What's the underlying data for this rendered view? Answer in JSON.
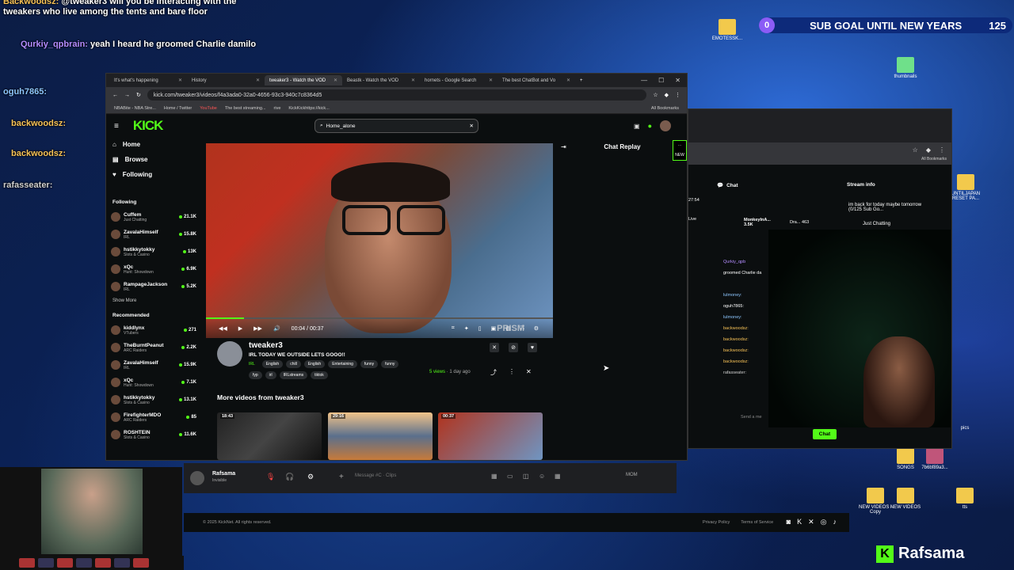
{
  "overlay_chat": [
    {
      "user": "Backwoodsz:",
      "text": "@tweaker3 will you be interacting with the tweakers who live among the tents and bare floor",
      "color": "orange"
    },
    {
      "user": "Qurkiy_qpbrain:",
      "text": "yeah I heard he groomed Charlie damilo",
      "color": "purple"
    },
    {
      "user": "oguh7865:",
      "text": "",
      "color": "blue"
    },
    {
      "user": "backwoodsz:",
      "text": "",
      "color": "orange"
    },
    {
      "user": "backwoodsz:",
      "text": "",
      "color": "orange"
    },
    {
      "user": "rafasseater:",
      "text": "",
      "color": "grey"
    }
  ],
  "sub_goal": {
    "count": "0",
    "label": "SUB GOAL UNTIL NEW YEARS",
    "goal": "125"
  },
  "desktop_icons": [
    {
      "label": "EMOTESSK..."
    },
    {
      "label": "thumbnails"
    },
    {
      "label": "UNTILJAPAN RESET PA..."
    },
    {
      "label": "SONGS"
    },
    {
      "label": "7b6bf89a3..."
    },
    {
      "label": "NEW VIDEOS - Copy"
    },
    {
      "label": "NEW VIDEOS"
    },
    {
      "label": "tts"
    },
    {
      "label": "pics"
    }
  ],
  "browser": {
    "tabs": [
      "It's what's happening",
      "History",
      "tweaker3 - Watch the VOD",
      "Beastk - Watch the VOD",
      "hornets - Google Search",
      "The best ChatBot and Vo"
    ],
    "url": "kick.com/tweaker3/videos/f4a3ada0-32a0-4656-93c3-940c7c8364d5",
    "bookmarks": [
      "NBABite - NBA Stre...",
      "Home / Twitter",
      "YouTube",
      "The best streaming...",
      "rive",
      "KickKickhttps://kick..."
    ],
    "all_bookmarks": "All Bookmarks"
  },
  "kick": {
    "search_value": "Home_alone",
    "nav": [
      {
        "label": "Home"
      },
      {
        "label": "Browse"
      },
      {
        "label": "Following"
      }
    ],
    "following_title": "Following",
    "following": [
      {
        "name": "Cuffem",
        "cat": "Just Chatting",
        "viewers": "21.1K"
      },
      {
        "name": "ZavalaHimself",
        "cat": "IRL",
        "viewers": "15.8K"
      },
      {
        "name": "hstikkytokky",
        "cat": "Slots & Casino",
        "viewers": "13K"
      },
      {
        "name": "xQc",
        "cat": "Hunt: Showdown",
        "viewers": "6.9K"
      },
      {
        "name": "RampageJackson",
        "cat": "IRL",
        "viewers": "5.2K"
      }
    ],
    "show_more": "Show More",
    "recommended_title": "Recommended",
    "recommended": [
      {
        "name": "kiddlynx",
        "cat": "VTubers",
        "viewers": "271"
      },
      {
        "name": "TheBurntPeanut",
        "cat": "ARC Raiders",
        "viewers": "2.2K"
      },
      {
        "name": "ZavalaHimself",
        "cat": "IRL",
        "viewers": "15.9K"
      },
      {
        "name": "xQc",
        "cat": "Hunt: Showdown",
        "viewers": "7.1K"
      },
      {
        "name": "hstikkytokky",
        "cat": "Slots & Casino",
        "viewers": "13.1K"
      },
      {
        "name": "FirefighterMDO",
        "cat": "ARC Raiders",
        "viewers": "85"
      },
      {
        "name": "ROSHTEIN",
        "cat": "Slots & Casino",
        "viewers": "11.6K"
      }
    ],
    "player": {
      "time": "00:04 / 00:37",
      "progress": 0.11,
      "watermark": "PRISM"
    },
    "chat_replay": "Chat Replay",
    "new_badge": "NEW",
    "streamer": "tweaker3",
    "title": "IRL TODAY WE OUTSIDE LETS GOOO!!",
    "category": "IRL",
    "tags": [
      "English",
      "chill",
      "English",
      "Entertaining",
      "funny",
      "funny",
      "fyp",
      "irl",
      "IRLstreams",
      "tiktok"
    ],
    "views": "5 views",
    "ago": "1 day ago",
    "more_videos": "More videos from tweaker3",
    "thumbs": [
      {
        "dur": "18:43"
      },
      {
        "dur": "29:16"
      },
      {
        "dur": "00:37"
      }
    ]
  },
  "browser2": {
    "all_bookmarks": "All Bookmarks",
    "chat_label": "Chat",
    "stream_info": "Stream info",
    "time": "27:54",
    "top_user": "MonkeyInA...",
    "top_user_sub": "3.5K",
    "top_right": "Dra...",
    "top_right_count": "463",
    "stream_title": "im back for today maybe tomorrow (0/125 Sub Go...",
    "stream_cat": "Just Chatting",
    "chat_users": [
      "Qurkiy_qpb",
      "groomed Charlie da",
      "lulmoney:",
      "oguh7865:",
      "lulmoney:",
      "backwoodsz:",
      "backwoodsz:",
      "backwoodsz:",
      "backwoodsz:",
      "rafasseater:"
    ],
    "send_placeholder": "Send a me",
    "chat_button": "Chat",
    "live": "Live"
  },
  "discord": {
    "name": "Rafsama",
    "status": "Invisible",
    "message_placeholder": "Message #C",
    "clips": "Clips",
    "mom": "MOM"
  },
  "footer": {
    "copy": "© 2025 KickNet. All rights reserved.",
    "privacy": "Privacy Policy",
    "terms": "Terms of Service"
  },
  "brand": "Rafsama"
}
